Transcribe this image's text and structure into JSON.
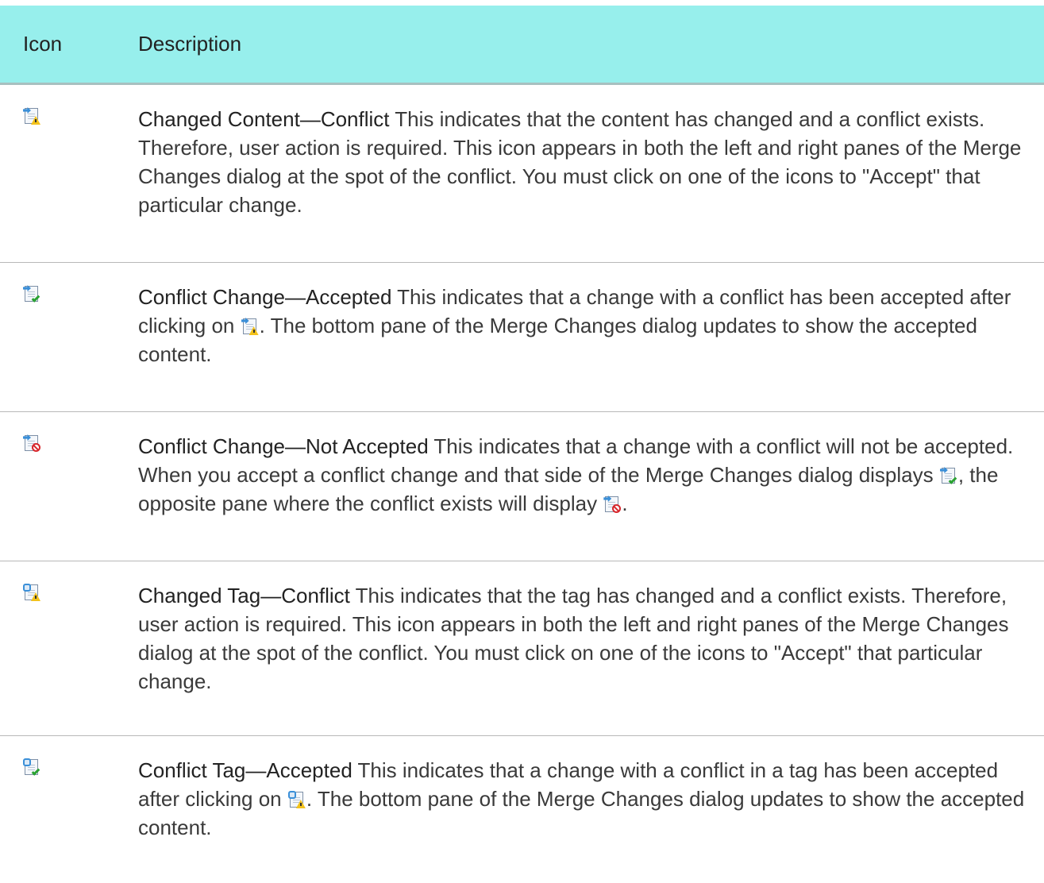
{
  "header": {
    "icon_col": "Icon",
    "desc_col": "Description"
  },
  "rows": [
    {
      "icon": "changed-content-conflict-icon",
      "term": "Changed Content—Conflict",
      "text": " This indicates that the content has changed and a conflict exists. Therefore, user action is required. This icon appears in both the left and right panes of the Merge Changes dialog at the spot of the conflict. You must click on one of the icons to \"Accept\" that particular change."
    },
    {
      "icon": "conflict-change-accepted-icon",
      "term": "Conflict Change—Accepted",
      "text_a": " This indicates that a change with a conflict has been accepted after clicking on ",
      "text_b": ". The bottom pane of the Merge Changes dialog updates to show the accepted content."
    },
    {
      "icon": "conflict-change-not-accepted-icon",
      "term": "Conflict Change—Not Accepted",
      "text_a": " This indicates that a change with a conflict will not be accepted. When you accept a conflict change and that side of the Merge Changes dialog displays ",
      "text_b": ", the opposite pane where the conflict exists will display ",
      "text_c": "."
    },
    {
      "icon": "changed-tag-conflict-icon",
      "term": "Changed Tag—Conflict",
      "text": " This indicates that the tag has changed and a conflict exists. Therefore, user action is required. This icon appears in both the left and right panes of the Merge Changes dialog at the spot of the conflict. You must click on one of the icons to \"Accept\" that particular change."
    },
    {
      "icon": "conflict-tag-accepted-icon",
      "term": "Conflict Tag—Accepted",
      "text_a": " This indicates that a change with a conflict in a tag has been accepted after clicking on ",
      "text_b": ". The bottom pane of the Merge Changes dialog updates to show the accepted content."
    }
  ],
  "colors": {
    "header_bg": "#97efec",
    "header_border": "#a8c0c0",
    "row_divider": "#b8b8b8",
    "text": "#3a3a3a"
  }
}
